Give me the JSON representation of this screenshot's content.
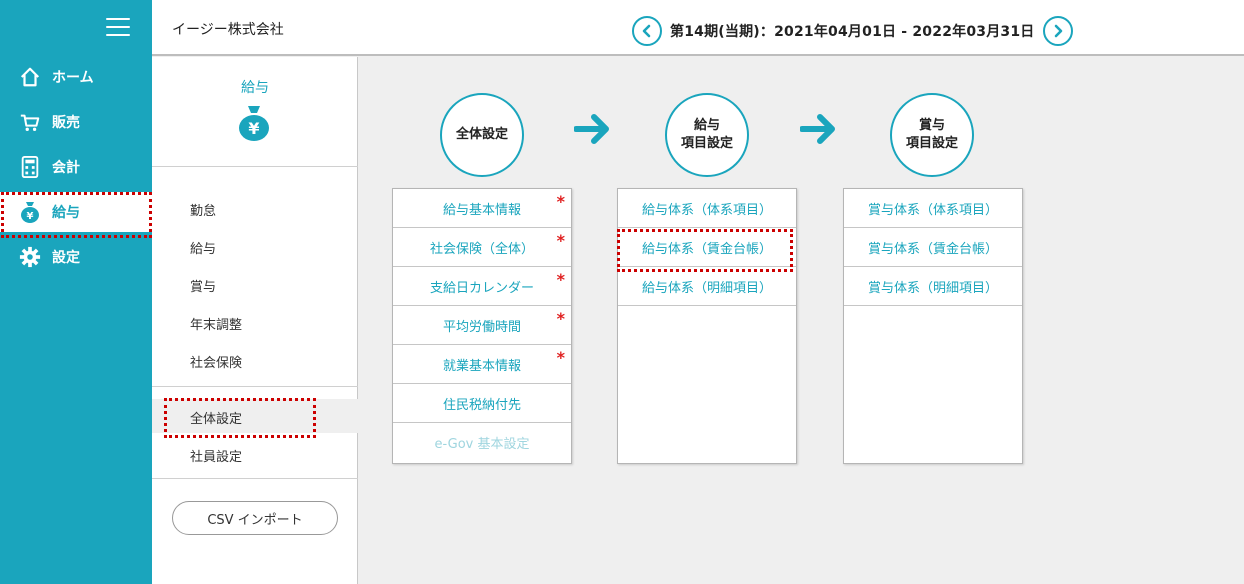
{
  "sidebar": {
    "items": [
      {
        "label": "ホーム",
        "icon": "home-icon"
      },
      {
        "label": "販売",
        "icon": "cart-icon"
      },
      {
        "label": "会計",
        "icon": "calculator-icon"
      },
      {
        "label": "給与",
        "icon": "money-bag-icon"
      },
      {
        "label": "設定",
        "icon": "gear-icon"
      }
    ],
    "active_index": 3
  },
  "header": {
    "company": "イージー株式会社",
    "period": "第14期(当期)：2021年04月01日 - 2022年03月31日"
  },
  "submenu": {
    "title": "給与",
    "items": [
      "勤怠",
      "給与",
      "賞与",
      "年末調整",
      "社会保険"
    ],
    "setting_items": [
      "全体設定",
      "社員設定"
    ],
    "active": "全体設定",
    "csv_button": "CSV インポート"
  },
  "flow": {
    "steps": [
      {
        "line1": "全体設定",
        "line2": ""
      },
      {
        "line1": "給与",
        "line2": "項目設定"
      },
      {
        "line1": "賞与",
        "line2": "項目設定"
      }
    ],
    "panels": [
      {
        "rows": [
          {
            "label": "給与基本情報",
            "required": true
          },
          {
            "label": "社会保険（全体）",
            "required": true
          },
          {
            "label": "支給日カレンダー",
            "required": true
          },
          {
            "label": "平均労働時間",
            "required": true
          },
          {
            "label": "就業基本情報",
            "required": true
          },
          {
            "label": "住民税納付先",
            "required": false
          },
          {
            "label": "e-Gov 基本設定",
            "required": false
          }
        ]
      },
      {
        "rows": [
          {
            "label": "給与体系（体系項目）"
          },
          {
            "label": "給与体系（賃金台帳）"
          },
          {
            "label": "給与体系（明細項目）"
          }
        ]
      },
      {
        "rows": [
          {
            "label": "賞与体系（体系項目）"
          },
          {
            "label": "賞与体系（賃金台帳）"
          },
          {
            "label": "賞与体系（明細項目）"
          }
        ]
      }
    ],
    "required_mark": "*"
  },
  "colors": {
    "accent": "#1aa5bd",
    "required": "#e02020",
    "highlight": "#cc0000"
  }
}
